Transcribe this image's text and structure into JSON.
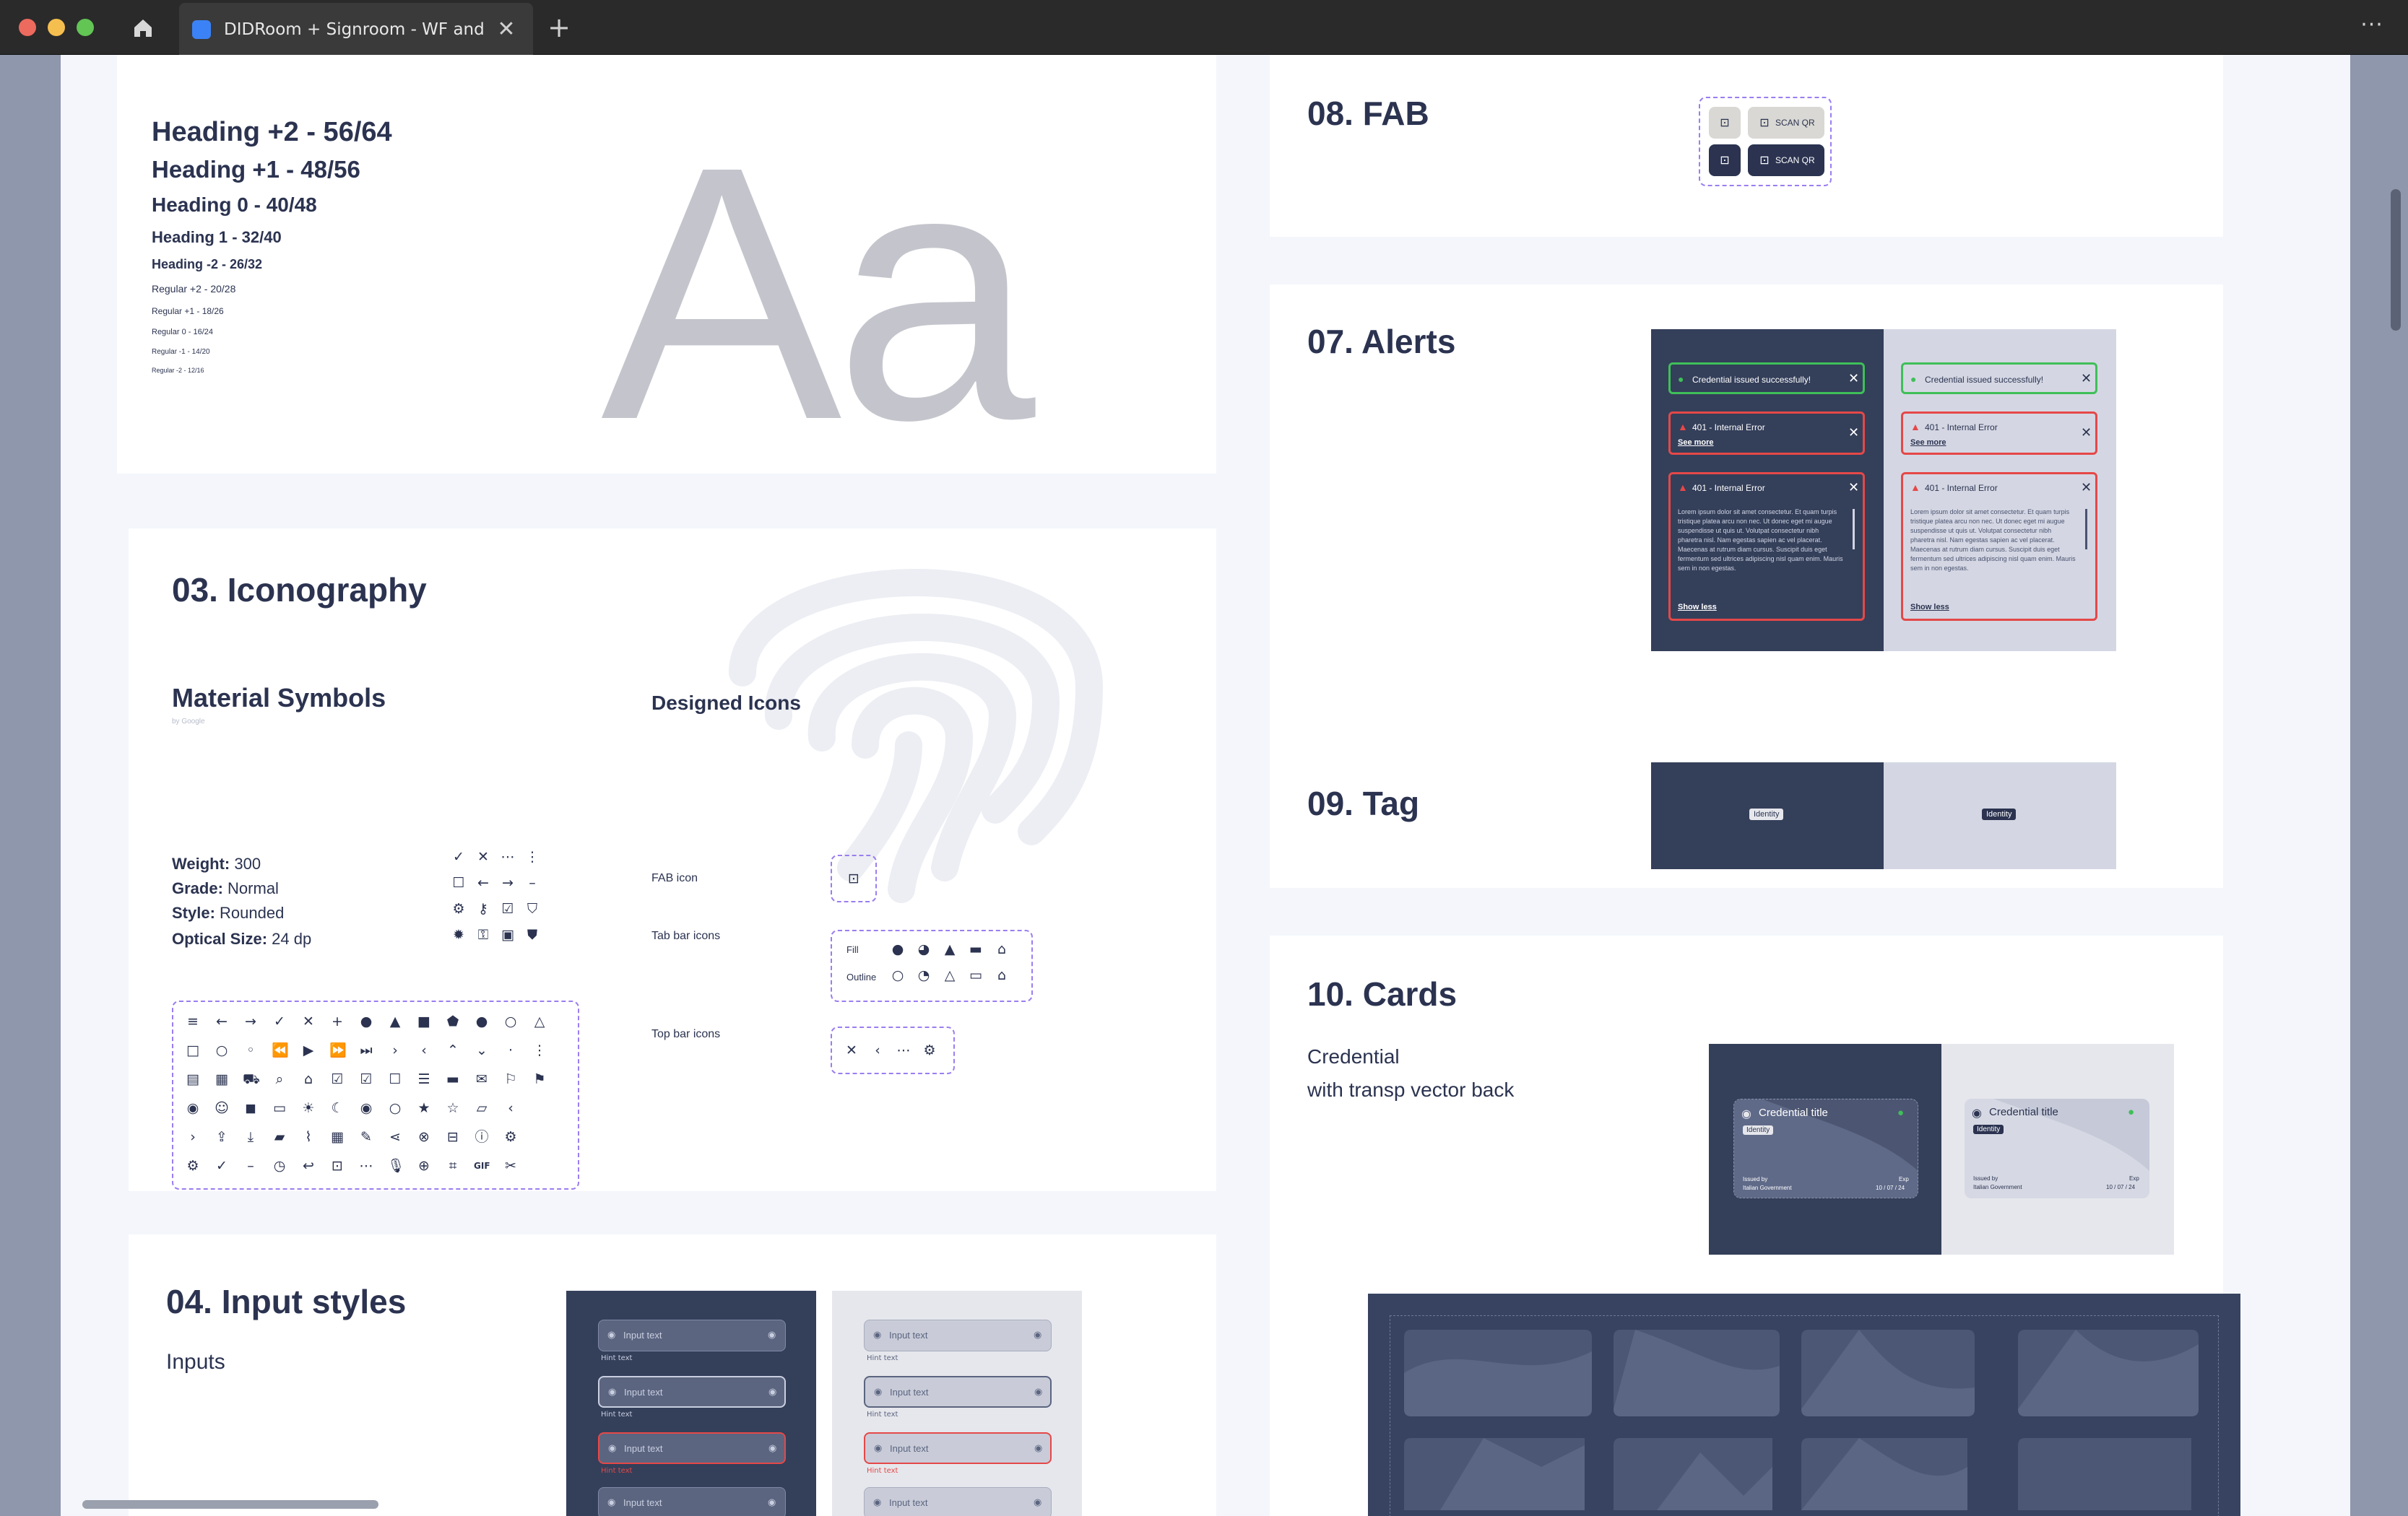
{
  "window": {
    "tab_title": "DIDRoom + Signroom - WF and GUI",
    "tab_close": "✕",
    "new_tab": "+",
    "more": "···"
  },
  "typography": {
    "headings": [
      "Heading +2 - 56/64",
      "Heading +1 - 48/56",
      "Heading 0 - 40/48",
      "Heading 1 - 32/40",
      "Heading -2 - 26/32"
    ],
    "regulars": [
      "Regular +2 - 20/28",
      "Regular +1 - 18/26",
      "Regular 0 - 16/24",
      "Regular -1 - 14/20",
      "Regular -2 - 12/16"
    ],
    "sample": "Aa"
  },
  "iconography": {
    "title": "03. Iconography",
    "material_title": "Material Symbols",
    "material_by": "by Google",
    "weight_label": "Weight:",
    "weight_value": "300",
    "grade_label": "Grade:",
    "grade_value": "Normal",
    "style_label": "Style:",
    "style_value": "Rounded",
    "optical_label": "Optical Size:",
    "optical_value": "24 dp",
    "designed_title": "Designed Icons",
    "fab_icon_label": "FAB icon",
    "tab_bar_label": "Tab bar icons",
    "fill_label": "Fill",
    "outline_label": "Outline",
    "top_bar_label": "Top bar icons"
  },
  "inputs": {
    "title": "04. Input styles",
    "subtitle": "Inputs",
    "placeholder": "Input text",
    "hint": "Hint text"
  },
  "fab": {
    "title": "08. FAB",
    "scan_label": "SCAN QR"
  },
  "alerts": {
    "title": "07. Alerts",
    "success": "Credential issued successfully!",
    "error": "401 - Internal Error",
    "see_more": "See more",
    "show_less": "Show less",
    "lorem": "Lorem ipsum dolor sit amet consectetur. Et quam turpis tristique platea arcu non nec. Ut donec eget mi augue suspendisse ut quis ut. Volutpat consectetur nibh pharetra nisl. Nam egestas sapien ac vel placerat. Maecenas at rutrum diam cursus. Suscipit duis eget fermentum sed ultrices adipiscing nisl quam enim. Mauris sem in non egestas."
  },
  "tag": {
    "title": "09. Tag",
    "label": "Identity"
  },
  "cards": {
    "title": "10. Cards",
    "subtitle_line1": "Credential",
    "subtitle_line2": "with transp vector back",
    "credential_title": "Credential title",
    "tag": "Identity",
    "issued_by_label": "Issued by",
    "issuer": "Italian Government",
    "exp_label": "Exp",
    "exp_date": "10 / 07 / 24"
  },
  "colors": {
    "navy": "#343f5a",
    "light": "#d4d7e3",
    "accent_dashed": "#9b7df0",
    "success": "#3fbf58",
    "error": "#e54848"
  }
}
